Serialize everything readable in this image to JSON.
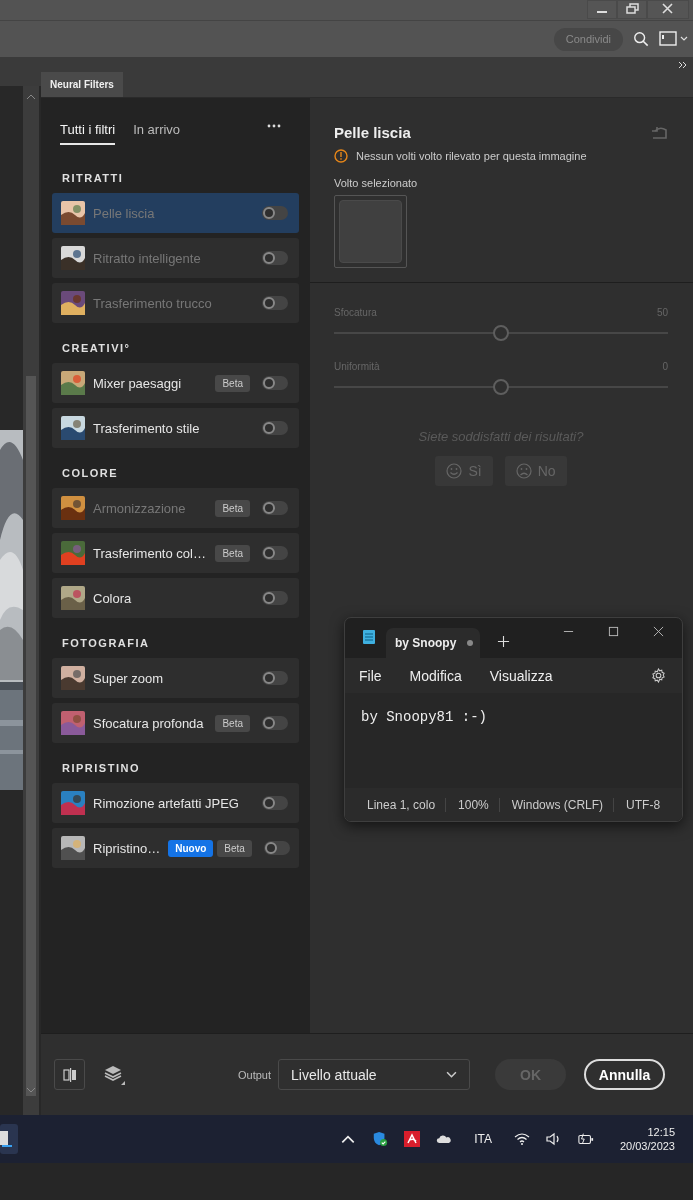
{
  "options_bar": {
    "share_button": "Condividi"
  },
  "panel": {
    "tab": "Neural Filters"
  },
  "filter_tabs": [
    {
      "label": "Tutti i filtri",
      "selected": true
    },
    {
      "label": "In arrivo",
      "selected": false
    }
  ],
  "categories": [
    {
      "title": "RITRATTI",
      "filters": [
        {
          "name": "Pelle liscia",
          "selected": true,
          "disabled": true,
          "on": false
        },
        {
          "name": "Ritratto intelligente",
          "selected": false,
          "disabled": true,
          "on": false
        },
        {
          "name": "Trasferimento trucco",
          "selected": false,
          "disabled": true,
          "on": false
        }
      ]
    },
    {
      "title": "CREATIVI°",
      "filters": [
        {
          "name": "Mixer paesaggi",
          "selected": false,
          "disabled": false,
          "on": false,
          "badges": [
            {
              "label": "Beta",
              "kind": "beta"
            }
          ]
        },
        {
          "name": "Trasferimento stile",
          "selected": false,
          "disabled": false,
          "on": false
        }
      ]
    },
    {
      "title": "COLORE",
      "filters": [
        {
          "name": "Armonizzazione",
          "selected": false,
          "disabled": true,
          "on": false,
          "badges": [
            {
              "label": "Beta",
              "kind": "beta"
            }
          ]
        },
        {
          "name": "Trasferimento col…",
          "selected": false,
          "disabled": false,
          "on": false,
          "badges": [
            {
              "label": "Beta",
              "kind": "beta"
            }
          ]
        },
        {
          "name": "Colora",
          "selected": false,
          "disabled": false,
          "on": false
        }
      ]
    },
    {
      "title": "FOTOGRAFIA",
      "filters": [
        {
          "name": "Super zoom",
          "selected": false,
          "disabled": false,
          "on": false
        },
        {
          "name": "Sfocatura profonda",
          "selected": false,
          "disabled": false,
          "on": false,
          "badges": [
            {
              "label": "Beta",
              "kind": "beta"
            }
          ]
        }
      ]
    },
    {
      "title": "RIPRISTINO",
      "filters": [
        {
          "name": "Rimozione artefatti JPEG",
          "selected": false,
          "disabled": false,
          "on": false
        },
        {
          "name": "Ripristino…",
          "selected": false,
          "disabled": false,
          "on": false,
          "badges": [
            {
              "label": "Nuovo",
              "kind": "new"
            },
            {
              "label": "Beta",
              "kind": "beta"
            }
          ]
        }
      ]
    }
  ],
  "detail": {
    "title": "Pelle liscia",
    "warning": "Nessun volti volto rilevato per questa immagine",
    "face_label": "Volto selezionato",
    "sliders": [
      {
        "label": "Sfocatura",
        "reading": "50",
        "level": 0.5
      },
      {
        "label": "Uniformità",
        "reading": "0",
        "level": 0.5
      }
    ],
    "question": "Siete soddisfatti dei risultati?",
    "feedback": [
      {
        "label": "Sì",
        "kind": "happy"
      },
      {
        "label": "No",
        "kind": "sad"
      }
    ]
  },
  "bottom_bar": {
    "output_label": "Output",
    "output_value": "Livello attuale",
    "ok": "OK",
    "cancel": "Annulla"
  },
  "notepad": {
    "tab": "by Snoopy",
    "modified": true,
    "menus": [
      "File",
      "Modifica",
      "Visualizza"
    ],
    "content": "by Snoopy81 :-)",
    "status": [
      "Linea 1, colo",
      "100%",
      "Windows (CRLF)",
      "UTF-8"
    ]
  },
  "taskbar": {
    "language": "ITA",
    "time": "12:15",
    "date": "20/03/2023"
  }
}
